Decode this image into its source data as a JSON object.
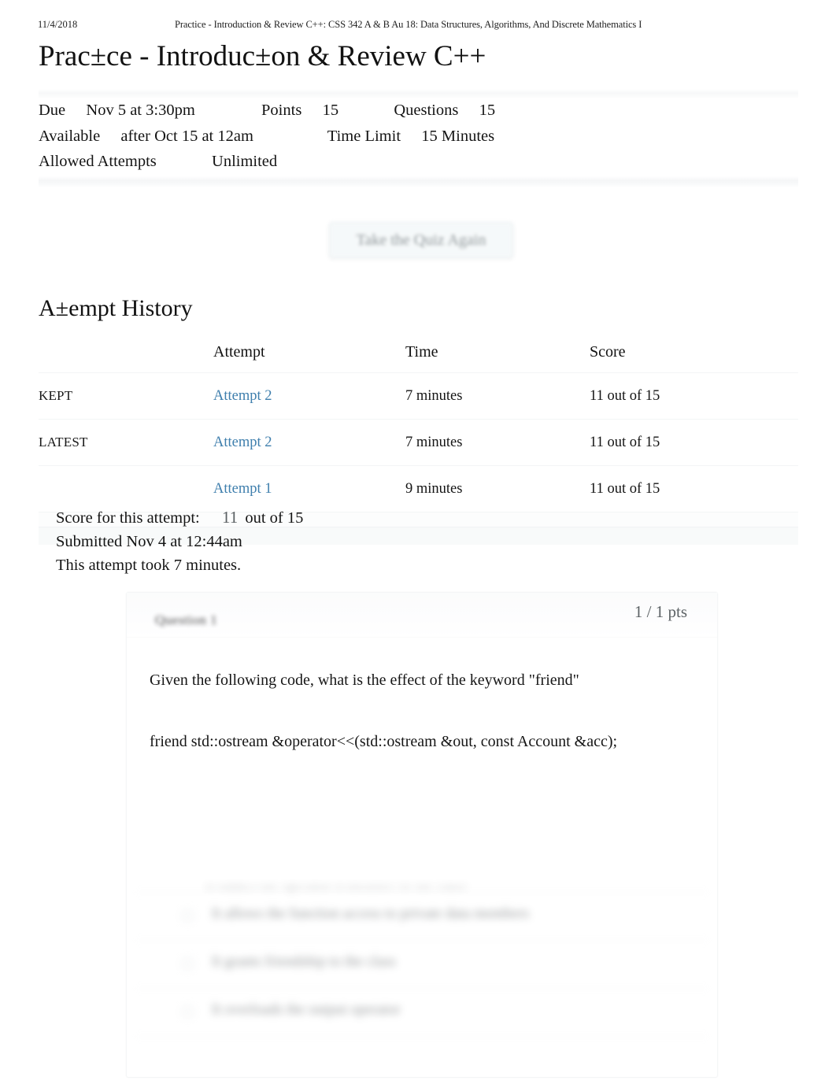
{
  "print_header": {
    "date": "11/4/2018",
    "title": "Practice - Introduction & Review C++: CSS 342 A & B Au 18: Data Structures, Algorithms, And Discrete Mathematics I"
  },
  "page": {
    "title": "Prac±ce - Introduc±on & Review C++"
  },
  "quiz_meta": {
    "due_label": "Due",
    "due_value": "Nov 5 at 3:30pm",
    "points_label": "Points",
    "points_value": "15",
    "questions_label": "Questions",
    "questions_value": "15",
    "available_label": "Available",
    "available_value": "after Oct 15 at 12am",
    "time_limit_label": "Time Limit",
    "time_limit_value": "15 Minutes",
    "allowed_attempts_label": "Allowed Attempts",
    "allowed_attempts_value": "Unlimited"
  },
  "actions": {
    "retake_label": "Take the Quiz Again"
  },
  "history": {
    "heading": "A±empt History",
    "columns": [
      "",
      "Attempt",
      "Time",
      "Score"
    ],
    "rows": [
      {
        "flag": "KEPT",
        "attempt": "Attempt 2",
        "time": "7 minutes",
        "score": "11 out of 15"
      },
      {
        "flag": "LATEST",
        "attempt": "Attempt 2",
        "time": "7 minutes",
        "score": "11 out of 15"
      },
      {
        "flag": "",
        "attempt": "Attempt 1",
        "time": "9 minutes",
        "score": "11 out of 15"
      }
    ]
  },
  "attempt_summary": {
    "score_label": "Score for this attempt:",
    "score_value": "11",
    "score_suffix": "out of 15",
    "submitted": "Submitted Nov 4 at 12:44am",
    "duration": "This attempt took 7 minutes."
  },
  "question": {
    "label": "Question 1",
    "points": "1 / 1 pts",
    "prompt": "Given the following code, what is the effect of the keyword \"friend\"",
    "code": "friend std::ostream &operator<<(std::ostream &out, const Account &acc);",
    "answers": [
      "It allows the function access to private data members",
      "It grants friendship to the class",
      "It overloads the output operator"
    ],
    "answer_top_clipped": "It makes the operator a member of the class"
  },
  "colors": {
    "link": "#3f7fad",
    "text": "#141414",
    "muted": "#5d6366",
    "background": "#ffffff",
    "band": "#f7f8f9"
  }
}
